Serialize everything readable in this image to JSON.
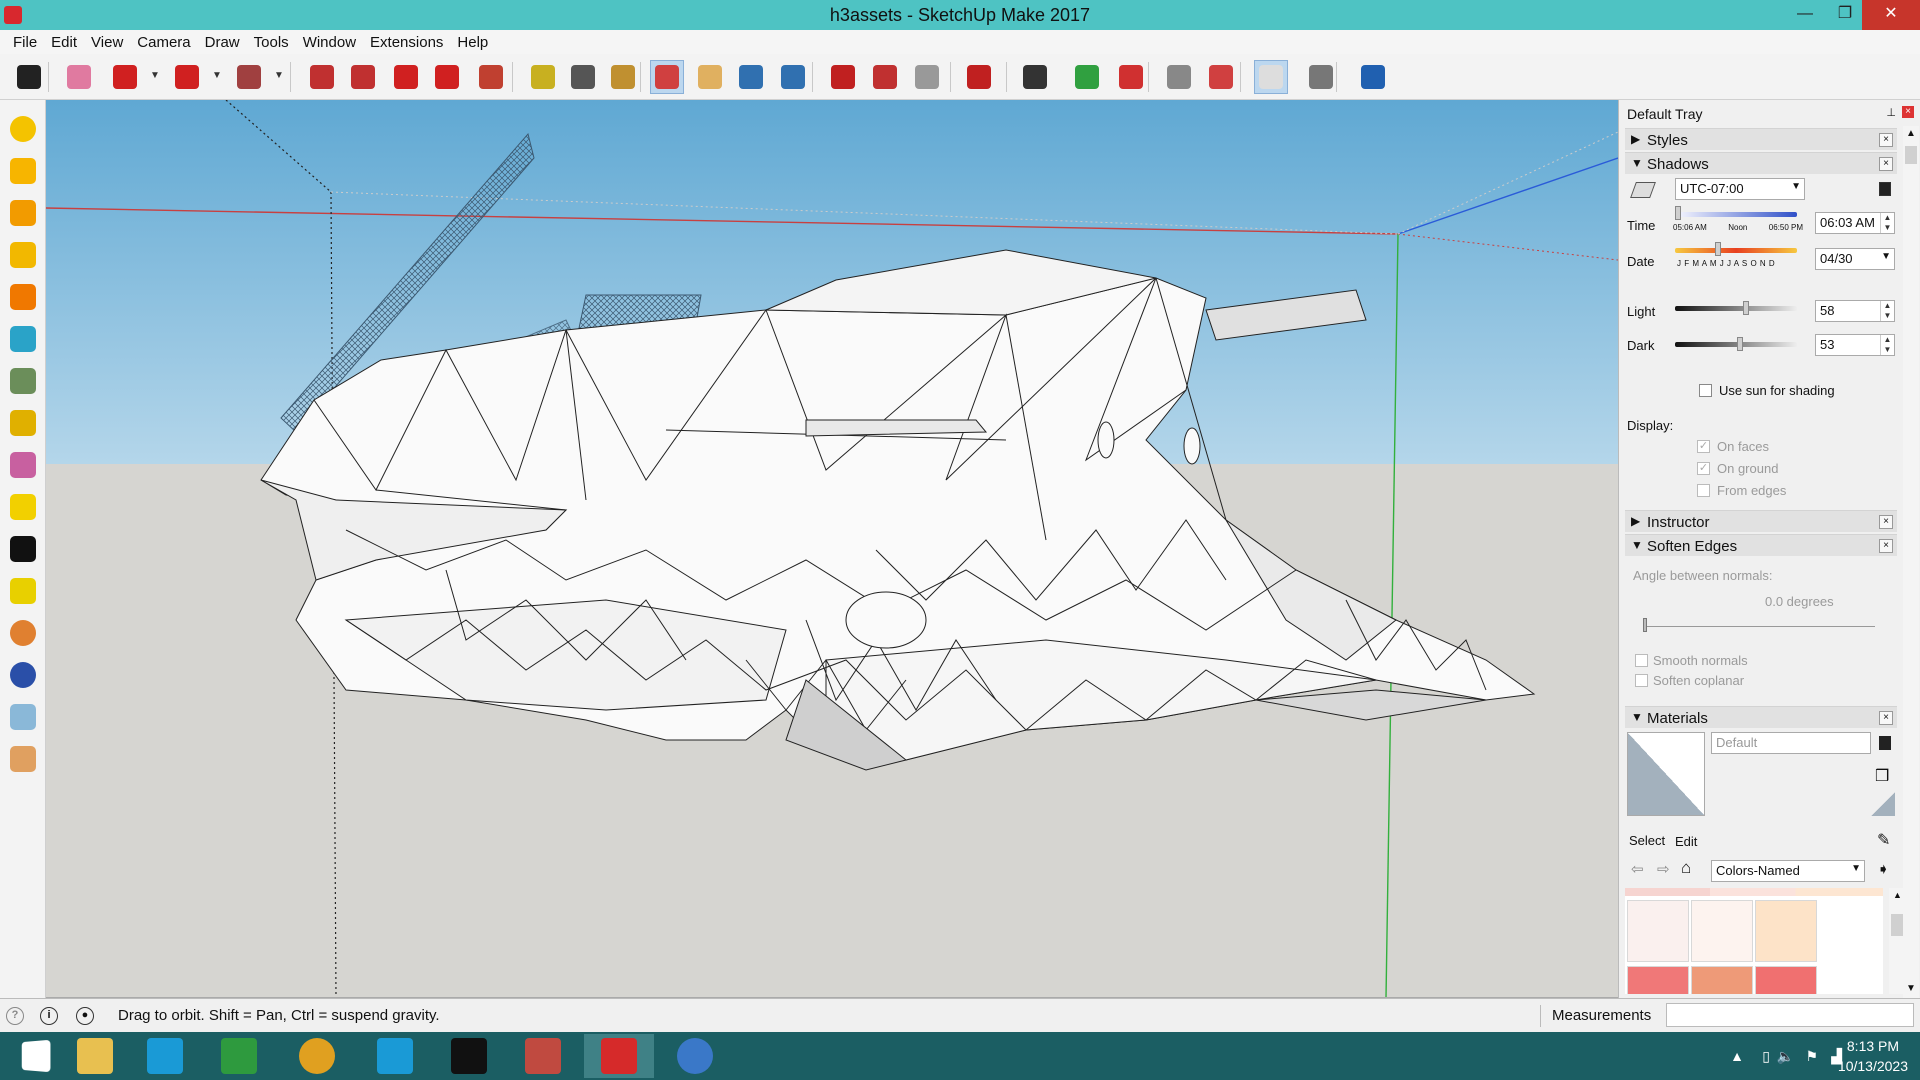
{
  "window": {
    "title": "h3assets - SketchUp Make 2017",
    "controls": {
      "minimize": "—",
      "maximize": "❐",
      "close": "✕"
    }
  },
  "menu": [
    "File",
    "Edit",
    "View",
    "Camera",
    "Draw",
    "Tools",
    "Window",
    "Extensions",
    "Help"
  ],
  "toolbar": {
    "tools": [
      {
        "name": "select-icon",
        "color": "#222222"
      },
      {
        "name": "eraser-icon",
        "color": "#e07aa0"
      },
      {
        "name": "pencil-icon",
        "color": "#d02020"
      },
      {
        "name": "arc-icon",
        "color": "#d02020"
      },
      {
        "name": "rectangle-icon",
        "color": "#a04040"
      },
      {
        "name": "push-pull-icon",
        "color": "#c03030"
      },
      {
        "name": "follow-me-icon",
        "color": "#c03030"
      },
      {
        "name": "move-icon",
        "color": "#d02020"
      },
      {
        "name": "rotate-icon",
        "color": "#d02020"
      },
      {
        "name": "scale-icon",
        "color": "#c04030"
      },
      {
        "name": "tape-measure-icon",
        "color": "#c8b020"
      },
      {
        "name": "text-icon",
        "color": "#555555"
      },
      {
        "name": "paint-bucket-icon",
        "color": "#c09030"
      },
      {
        "name": "orbit-icon",
        "color": "#d04040"
      },
      {
        "name": "pan-icon",
        "color": "#e0b060"
      },
      {
        "name": "zoom-icon",
        "color": "#3070b0"
      },
      {
        "name": "zoom-extents-icon",
        "color": "#3070b0"
      },
      {
        "name": "3d-warehouse-icon",
        "color": "#c02020"
      },
      {
        "name": "extension-warehouse-icon",
        "color": "#c03030"
      },
      {
        "name": "layout-icon",
        "color": "#999999"
      },
      {
        "name": "ruby-extension-icon",
        "color": "#c02020"
      },
      {
        "name": "iso-view-icon",
        "color": "#333333"
      },
      {
        "name": "add-location-icon",
        "color": "#30a040"
      },
      {
        "name": "geo-terrain-icon",
        "color": "#d03030"
      },
      {
        "name": "styles-icon",
        "color": "#888888"
      },
      {
        "name": "share-model-icon",
        "color": "#d04040"
      },
      {
        "name": "shadows-icon",
        "color": "#dddddd"
      },
      {
        "name": "fog-icon",
        "color": "#777777"
      },
      {
        "name": "help-icon",
        "color": "#2060b0"
      }
    ]
  },
  "left_tools": [
    "sun-icon",
    "sandbox-from-contours-icon",
    "sandbox-from-scratch-icon",
    "smoove-icon",
    "stamp-icon",
    "drape-icon",
    "add-detail-icon",
    "flip-edge-icon",
    "section-plane-icon",
    "hexagon-outline-icon",
    "hexagon-black-icon",
    "shield-yellow-icon",
    "sphere-orange-icon",
    "sphere-blue-icon",
    "eraser-blue-icon",
    "eraser-orange-icon"
  ],
  "status": {
    "hint": "Drag to orbit. Shift = Pan, Ctrl = suspend gravity.",
    "measurements_label": "Measurements",
    "measurements_value": ""
  },
  "tray": {
    "title": "Default Tray",
    "sections": {
      "styles": "Styles",
      "shadows": "Shadows",
      "instructor": "Instructor",
      "soften_edges": "Soften Edges",
      "materials": "Materials"
    },
    "shadows": {
      "timezone": "UTC-07:00",
      "time_label": "Time",
      "time_ticks": [
        "05:06 AM",
        "Noon",
        "06:50 PM"
      ],
      "time_value": "06:03 AM",
      "date_label": "Date",
      "months": "J F M A M J J A S O N D",
      "date_value": "04/30",
      "light_label": "Light",
      "light_value": "58",
      "light_fraction": 0.58,
      "dark_label": "Dark",
      "dark_value": "53",
      "dark_fraction": 0.53,
      "use_sun_label": "Use sun for shading",
      "display_label": "Display:",
      "on_faces": "On faces",
      "on_ground": "On ground",
      "from_edges": "From edges"
    },
    "soften": {
      "angle_label": "Angle between normals:",
      "angle_value": "0.0  degrees",
      "smooth_normals": "Smooth normals",
      "soften_coplanar": "Soften coplanar"
    },
    "materials": {
      "current": "Default",
      "tab_select": "Select",
      "tab_edit": "Edit",
      "library": "Colors-Named",
      "swatches": [
        "#faf0ee",
        "#fdf3ef",
        "#fde3c8",
        "#f07878",
        "#ee9a78",
        "#f07070"
      ]
    }
  },
  "taskbar": {
    "apps": [
      {
        "name": "windows-start-icon",
        "color": "#1b5e63"
      },
      {
        "name": "file-explorer-icon",
        "color": "#e8c050"
      },
      {
        "name": "cura-icon",
        "color": "#1a9ad6"
      },
      {
        "name": "calculator-icon",
        "color": "#2e9a3e"
      },
      {
        "name": "chrome-icon",
        "color": "#e0a020"
      },
      {
        "name": "cura-alt-icon",
        "color": "#1a9ad6"
      },
      {
        "name": "creality-icon",
        "color": "#111111"
      },
      {
        "name": "3d-builder-icon",
        "color": "#c04a40"
      },
      {
        "name": "sketchup-icon",
        "color": "#d62a2a"
      },
      {
        "name": "update-icon",
        "color": "#3a78c8"
      }
    ],
    "time": "8:13 PM",
    "date": "10/13/2023"
  }
}
